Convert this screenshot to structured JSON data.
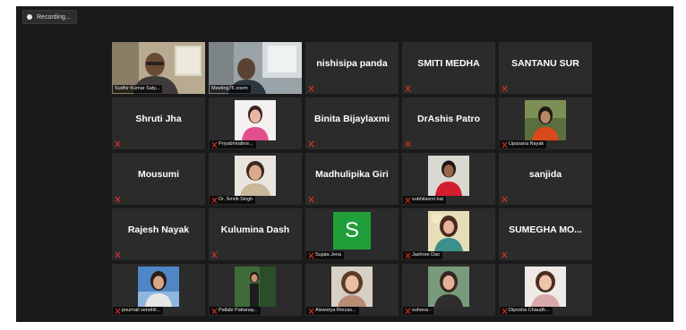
{
  "recording": {
    "label": "Recording..."
  },
  "tiles": [
    {
      "kind": "video",
      "label": "Sudhir Kumar Saty..."
    },
    {
      "kind": "video",
      "label": "Meeting76 zoom"
    },
    {
      "kind": "name",
      "name": "nishisipa panda"
    },
    {
      "kind": "name",
      "name": "SMITI MEDHA"
    },
    {
      "kind": "name",
      "name": "SANTANU SUR"
    },
    {
      "kind": "name",
      "name": "Shruti Jha"
    },
    {
      "kind": "photo",
      "label": "Priyabhirathor..."
    },
    {
      "kind": "name",
      "name": "Binita Bijaylaxmi"
    },
    {
      "kind": "name",
      "name": "DrAshis Patro"
    },
    {
      "kind": "photo",
      "label": "Upasana Nayak"
    },
    {
      "kind": "name",
      "name": "Mousumi"
    },
    {
      "kind": "photo",
      "label": "Dr. Smriti Singh"
    },
    {
      "kind": "name",
      "name": "Madhulipika Giri"
    },
    {
      "kind": "photo",
      "label": "subhilaxmi bal"
    },
    {
      "kind": "name",
      "name": "sanjida"
    },
    {
      "kind": "name",
      "name": "Rajesh  Nayak"
    },
    {
      "kind": "name",
      "name": "Kulumina Dash"
    },
    {
      "kind": "avatar",
      "letter": "S",
      "label": "Sujata Jena"
    },
    {
      "kind": "photo",
      "label": "Jashree Das"
    },
    {
      "kind": "name",
      "name": "SUMEGHA  MO..."
    },
    {
      "kind": "photo",
      "label": "pournali senehil..."
    },
    {
      "kind": "photo",
      "label": "Pallabi Pattanay..."
    },
    {
      "kind": "photo",
      "label": "Aiswarya Rmzas..."
    },
    {
      "kind": "photo",
      "label": "suhena -"
    },
    {
      "kind": "photo",
      "label": "Diposha Chaudh..."
    }
  ]
}
